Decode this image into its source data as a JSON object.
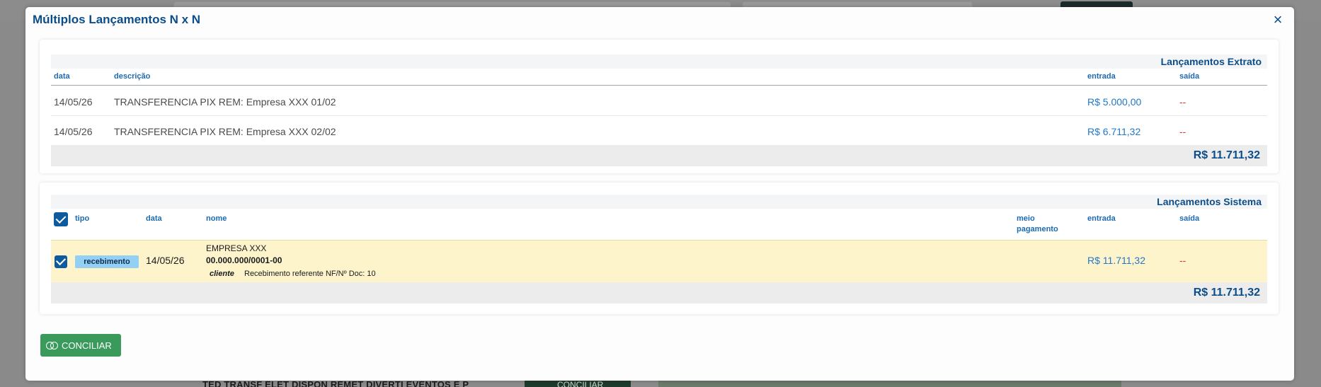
{
  "modal": {
    "title": "Múltiplos Lançamentos N x N",
    "close_icon": "close-icon"
  },
  "extrato": {
    "section_title": "Lançamentos Extrato",
    "columns": {
      "data": "data",
      "descricao": "descrição",
      "entrada": "entrada",
      "saida": "saída"
    },
    "rows": [
      {
        "data": "14/05/26",
        "descricao": "TRANSFERENCIA PIX REM: Empresa XXX 01/02",
        "entrada": "R$ 5.000,00",
        "saida": "--"
      },
      {
        "data": "14/05/26",
        "descricao": "TRANSFERENCIA PIX REM: Empresa XXX 02/02",
        "entrada": "R$ 6.711,32",
        "saida": "--"
      }
    ],
    "total": "R$ 11.711,32"
  },
  "sistema": {
    "section_title": "Lançamentos Sistema",
    "select_all_checked": true,
    "columns": {
      "tipo": "tipo",
      "data": "data",
      "nome": "nome",
      "meio": "meio",
      "pagamento": "pagamento",
      "entrada": "entrada",
      "saida": "saída"
    },
    "rows": [
      {
        "checked": true,
        "tipo": "recebimento",
        "data": "14/05/26",
        "nome": "EMPRESA XXX",
        "documento": "00.000.000/0001-00",
        "rotulo": "cliente",
        "descricao": "Recebimento referente NF/Nº Doc: 10",
        "entrada": "R$ 11.711,32",
        "saida": "--"
      }
    ],
    "total": "R$ 11.711,32"
  },
  "actions": {
    "conciliar_label": "CONCILIAR",
    "conciliar_icon": "link-rings-icon"
  },
  "background": {
    "row_text": "TED TRANSF ELET DISPON REMET DIVERTI EVENTOS E P",
    "button_label": "CONCILIAR"
  },
  "colors": {
    "accent": "#0b4d8a",
    "link": "#2278c8",
    "negative": "#dd3333",
    "highlight_row": "#fdf4cc",
    "tag_bg": "#93d0f3",
    "action_green": "#3a9a5b"
  }
}
